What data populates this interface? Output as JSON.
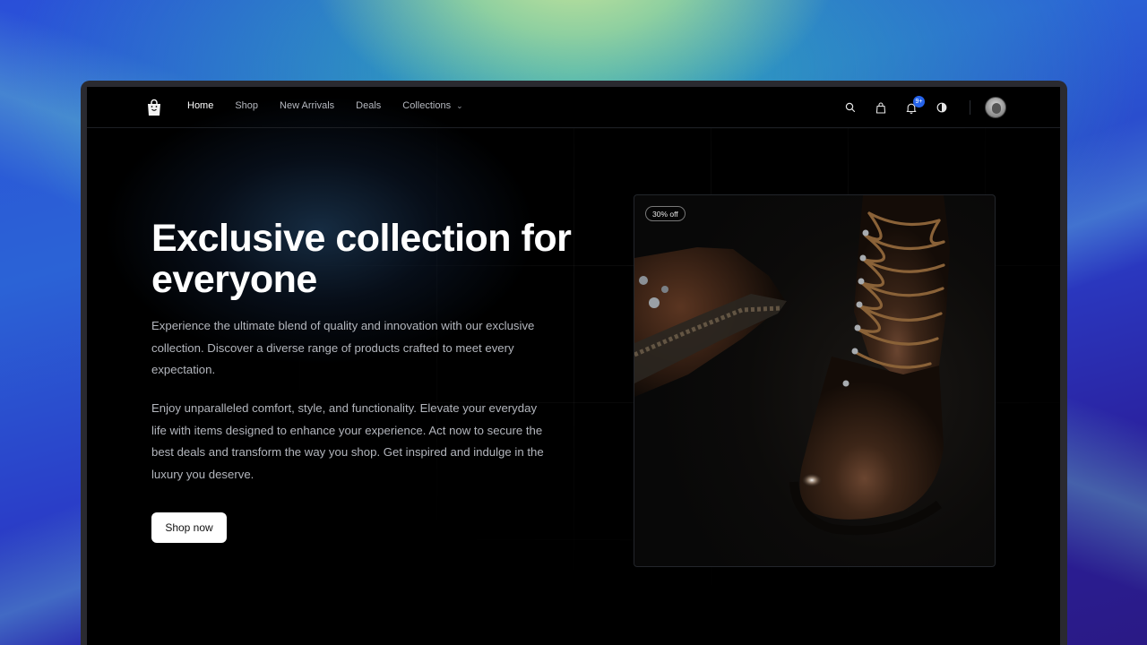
{
  "nav": {
    "links": [
      {
        "label": "Home",
        "active": true
      },
      {
        "label": "Shop"
      },
      {
        "label": "New Arrivals"
      },
      {
        "label": "Deals"
      },
      {
        "label": "Collections",
        "has_dropdown": true
      }
    ],
    "icons": [
      "search-icon",
      "shopping-bag-icon",
      "bell-icon",
      "theme-toggle-icon"
    ],
    "notification_badge": "9+"
  },
  "hero": {
    "title": "Exclusive collection for everyone",
    "paragraph1": "Experience the ultimate blend of quality and innovation with our exclusive collection. Discover a diverse range of products crafted to meet every expectation.",
    "paragraph2": "Enjoy unparalleled comfort, style, and functionality. Elevate your everyday life with items designed to enhance your experience. Act now to secure the best deals and transform the way you shop. Get inspired and indulge in the luxury you deserve.",
    "cta_label": "Shop now"
  },
  "product": {
    "badge": "30% off",
    "image": "leather-boots-photo"
  },
  "colors": {
    "accent_badge": "#2563eb",
    "page_bg": "#000000",
    "text_muted": "#b3b6bd"
  }
}
